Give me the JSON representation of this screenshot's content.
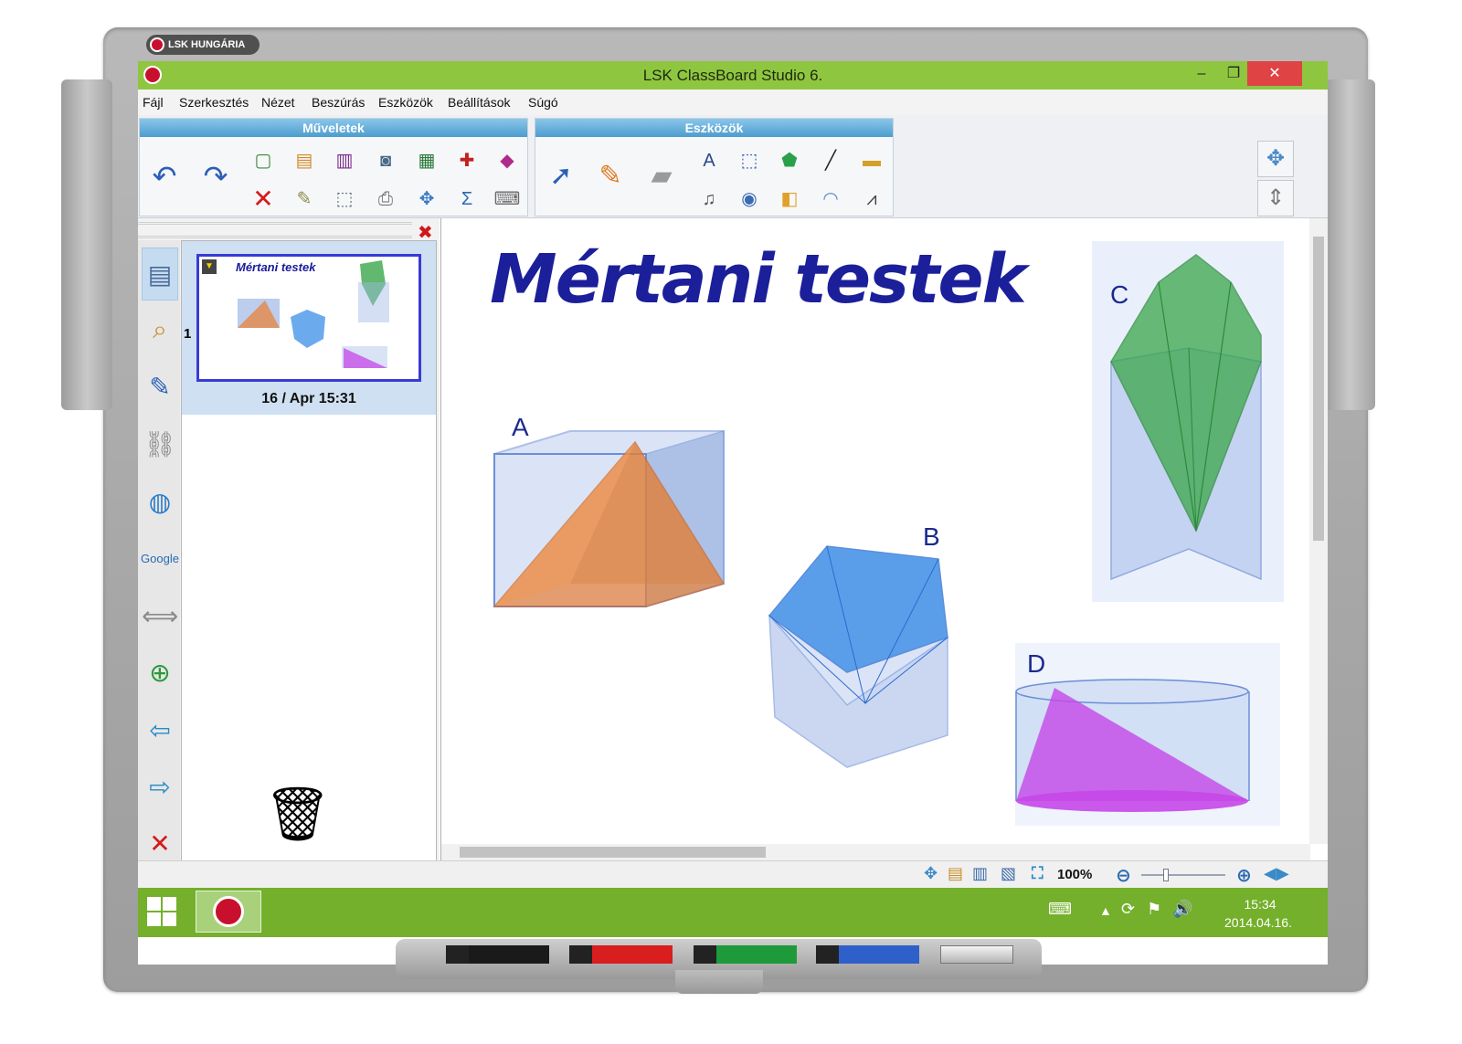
{
  "brand": {
    "name": "LSK HUNGÁRIA"
  },
  "window": {
    "title": "LSK ClassBoard Studio 6.",
    "minimize": "–",
    "maximize": "❐",
    "close": "✕"
  },
  "menu": [
    "Fájl",
    "Szerkesztés",
    "Nézet",
    "Beszúrás",
    "Eszközök",
    "Beállítások",
    "Súgó"
  ],
  "ribbon": {
    "group_operations": "Műveletek",
    "group_tools": "Eszközök",
    "operations_icons": [
      "undo-icon",
      "redo-icon",
      "new-page-icon",
      "screen-shade-icon",
      "film-icon",
      "camera-icon",
      "presentation-icon",
      "capture-icon",
      "3d-shapes-icon",
      "delete-icon",
      "spotlight-icon",
      "snapshot-icon",
      "scanner-icon",
      "move-icon",
      "formula-icon",
      "keyboard-icon"
    ],
    "tools_icons": [
      "select-arrow-icon",
      "pen-icon",
      "eraser-icon",
      "text-icon",
      "multi-select-icon",
      "shape-icon",
      "line-icon",
      "ruler-icon",
      "audio-text-icon",
      "fill-icon",
      "shapes-color-icon",
      "protractor-icon",
      "compass-icon"
    ]
  },
  "left_panel": {
    "close": "✖",
    "page_number": "1",
    "thumbnail_title": "Mértani testek",
    "page_date": "16 / Apr 15:31"
  },
  "canvas": {
    "title": "Mértani testek",
    "shapes": [
      {
        "label": "A",
        "kind": "cube-with-pyramid",
        "color": "#e8833a"
      },
      {
        "label": "B",
        "kind": "pentagonal-prism",
        "color": "#3b8de8"
      },
      {
        "label": "C",
        "kind": "triangular-prism-with-bipyramid",
        "color": "#3aa64a"
      },
      {
        "label": "D",
        "kind": "cylinder-with-triangle",
        "color": "#c547e8"
      }
    ]
  },
  "statusbar": {
    "zoom": "100%"
  },
  "taskbar": {
    "time": "15:34",
    "date": "2014.04.16."
  },
  "pen_colors": [
    "#1a1a1a",
    "#d81e1e",
    "#1e9a3a",
    "#2f5fc8"
  ]
}
